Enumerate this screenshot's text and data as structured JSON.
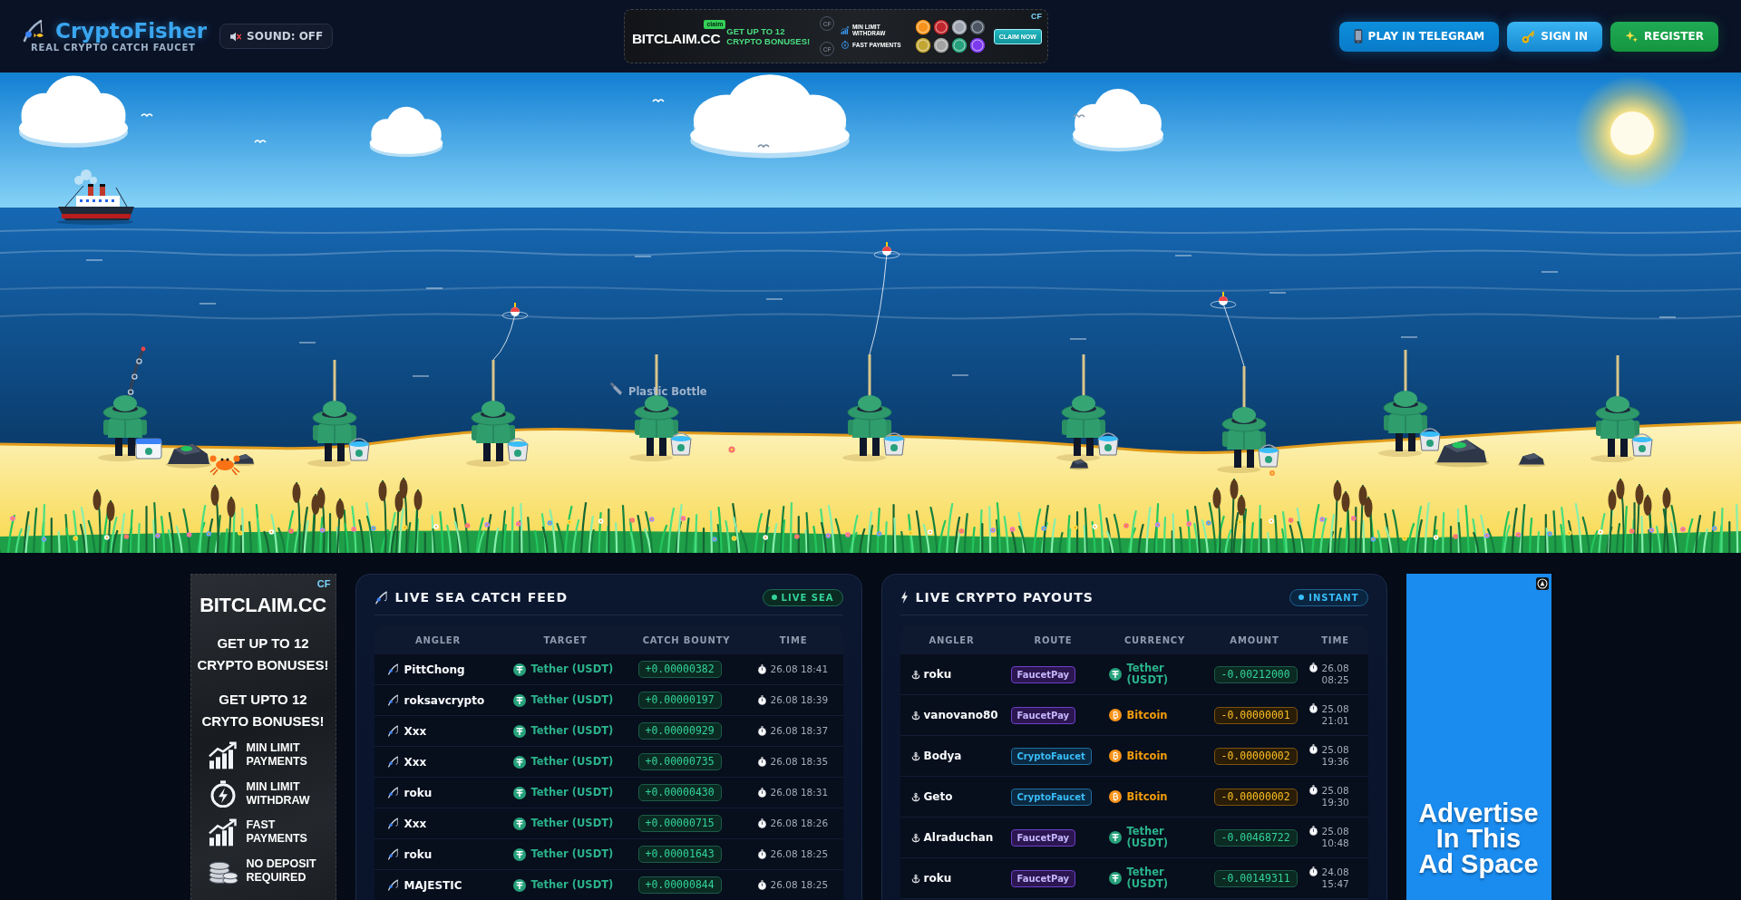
{
  "header": {
    "logo": {
      "title": "CryptoFisher",
      "subtitle": "REAL CRYPTO CATCH FAUCET"
    },
    "sound": {
      "label": "SOUND: OFF",
      "muted": true
    },
    "banner_ad": {
      "brand": "BITCLAIM.CC",
      "tag": "claim",
      "headline": "GET UP TO 12 CRYPTO BONUSES!",
      "marks": [
        "CF",
        "CF"
      ],
      "features": [
        {
          "text": "MIN LIMIT WITHDRAW",
          "kind": "chart"
        },
        {
          "text": "FAST PAYMENTS",
          "kind": "timer"
        }
      ],
      "cta": "CLAIM NOW",
      "corner_mark": "CF"
    },
    "buttons": [
      {
        "label": "PLAY IN TELEGRAM",
        "kind": "telegram"
      },
      {
        "label": "SIGN IN",
        "kind": "signin"
      },
      {
        "label": "REGISTER",
        "kind": "register"
      }
    ]
  },
  "scene": {
    "catch_label": "Plastic Bottle",
    "anglers": [
      {
        "kind": "reeling"
      },
      {
        "kind": "idle"
      },
      {
        "kind": "cast"
      },
      {
        "kind": "idle"
      },
      {
        "kind": "cast"
      },
      {
        "kind": "idle"
      },
      {
        "kind": "cast"
      },
      {
        "kind": "idle"
      },
      {
        "kind": "idle"
      }
    ]
  },
  "left_ad": {
    "corner_mark": "CF",
    "brand": "BITCLAIM.CC",
    "headlines": [
      "GET UP TO 12 CRYPTO BONUSES!",
      "GET UPTO 12 CRYTO BONUSES!"
    ],
    "features": [
      {
        "text": "MIN LIMIT PAYMENTS",
        "kind": "chart"
      },
      {
        "text": "MIN LIMIT WITHDRAW",
        "kind": "timer"
      },
      {
        "text": "FAST PAYMENTS",
        "kind": "chart"
      },
      {
        "text": "NO DEPOSIT REQUIRED",
        "kind": "coins"
      }
    ]
  },
  "catch_feed": {
    "title": "LIVE SEA CATCH FEED",
    "badge": "LIVE SEA",
    "columns": [
      "ANGLER",
      "TARGET",
      "CATCH BOUNTY",
      "TIME"
    ],
    "rows": [
      {
        "angler": "PittChong",
        "target": {
          "name": "Tether (USDT)",
          "kind": "usdt"
        },
        "bounty": "+0.00000382",
        "time": "26.08 18:41"
      },
      {
        "angler": "roksavcrypto",
        "target": {
          "name": "Tether (USDT)",
          "kind": "usdt"
        },
        "bounty": "+0.00000197",
        "time": "26.08 18:39"
      },
      {
        "angler": "Xxx",
        "target": {
          "name": "Tether (USDT)",
          "kind": "usdt"
        },
        "bounty": "+0.00000929",
        "time": "26.08 18:37"
      },
      {
        "angler": "Xxx",
        "target": {
          "name": "Tether (USDT)",
          "kind": "usdt"
        },
        "bounty": "+0.00000735",
        "time": "26.08 18:35"
      },
      {
        "angler": "roku",
        "target": {
          "name": "Tether (USDT)",
          "kind": "usdt"
        },
        "bounty": "+0.00000430",
        "time": "26.08 18:31"
      },
      {
        "angler": "Xxx",
        "target": {
          "name": "Tether (USDT)",
          "kind": "usdt"
        },
        "bounty": "+0.00000715",
        "time": "26.08 18:26"
      },
      {
        "angler": "roku",
        "target": {
          "name": "Tether (USDT)",
          "kind": "usdt"
        },
        "bounty": "+0.00001643",
        "time": "26.08 18:25"
      },
      {
        "angler": "MAJESTIC",
        "target": {
          "name": "Tether (USDT)",
          "kind": "usdt"
        },
        "bounty": "+0.00000844",
        "time": "26.08 18:25"
      }
    ]
  },
  "payouts": {
    "title": "LIVE CRYPTO PAYOUTS",
    "badge": "INSTANT",
    "columns": [
      "ANGLER",
      "ROUTE",
      "CURRENCY",
      "AMOUNT",
      "TIME"
    ],
    "rows": [
      {
        "angler": "roku",
        "route": {
          "label": "FaucetPay",
          "kind": "faucetpay"
        },
        "currency": {
          "name": "Tether (USDT)",
          "kind": "usdt"
        },
        "amount": "-0.00212000",
        "time": "26.08 08:25"
      },
      {
        "angler": "vanovano80",
        "route": {
          "label": "FaucetPay",
          "kind": "faucetpay"
        },
        "currency": {
          "name": "Bitcoin",
          "kind": "btc"
        },
        "amount": "-0.00000001",
        "time": "25.08 21:01"
      },
      {
        "angler": "Bodya",
        "route": {
          "label": "CryptoFaucet",
          "kind": "cryptofaucet"
        },
        "currency": {
          "name": "Bitcoin",
          "kind": "btc"
        },
        "amount": "-0.00000002",
        "time": "25.08 19:36"
      },
      {
        "angler": "Geto",
        "route": {
          "label": "CryptoFaucet",
          "kind": "cryptofaucet"
        },
        "currency": {
          "name": "Bitcoin",
          "kind": "btc"
        },
        "amount": "-0.00000002",
        "time": "25.08 19:30"
      },
      {
        "angler": "Alraduchan",
        "route": {
          "label": "FaucetPay",
          "kind": "faucetpay"
        },
        "currency": {
          "name": "Tether (USDT)",
          "kind": "usdt"
        },
        "amount": "-0.00468722",
        "time": "25.08 10:48"
      },
      {
        "angler": "roku",
        "route": {
          "label": "FaucetPay",
          "kind": "faucetpay"
        },
        "currency": {
          "name": "Tether (USDT)",
          "kind": "usdt"
        },
        "amount": "-0.00149311",
        "time": "24.08 15:47"
      }
    ]
  },
  "right_ad": {
    "text": "Advertise In This Ad Space"
  }
}
